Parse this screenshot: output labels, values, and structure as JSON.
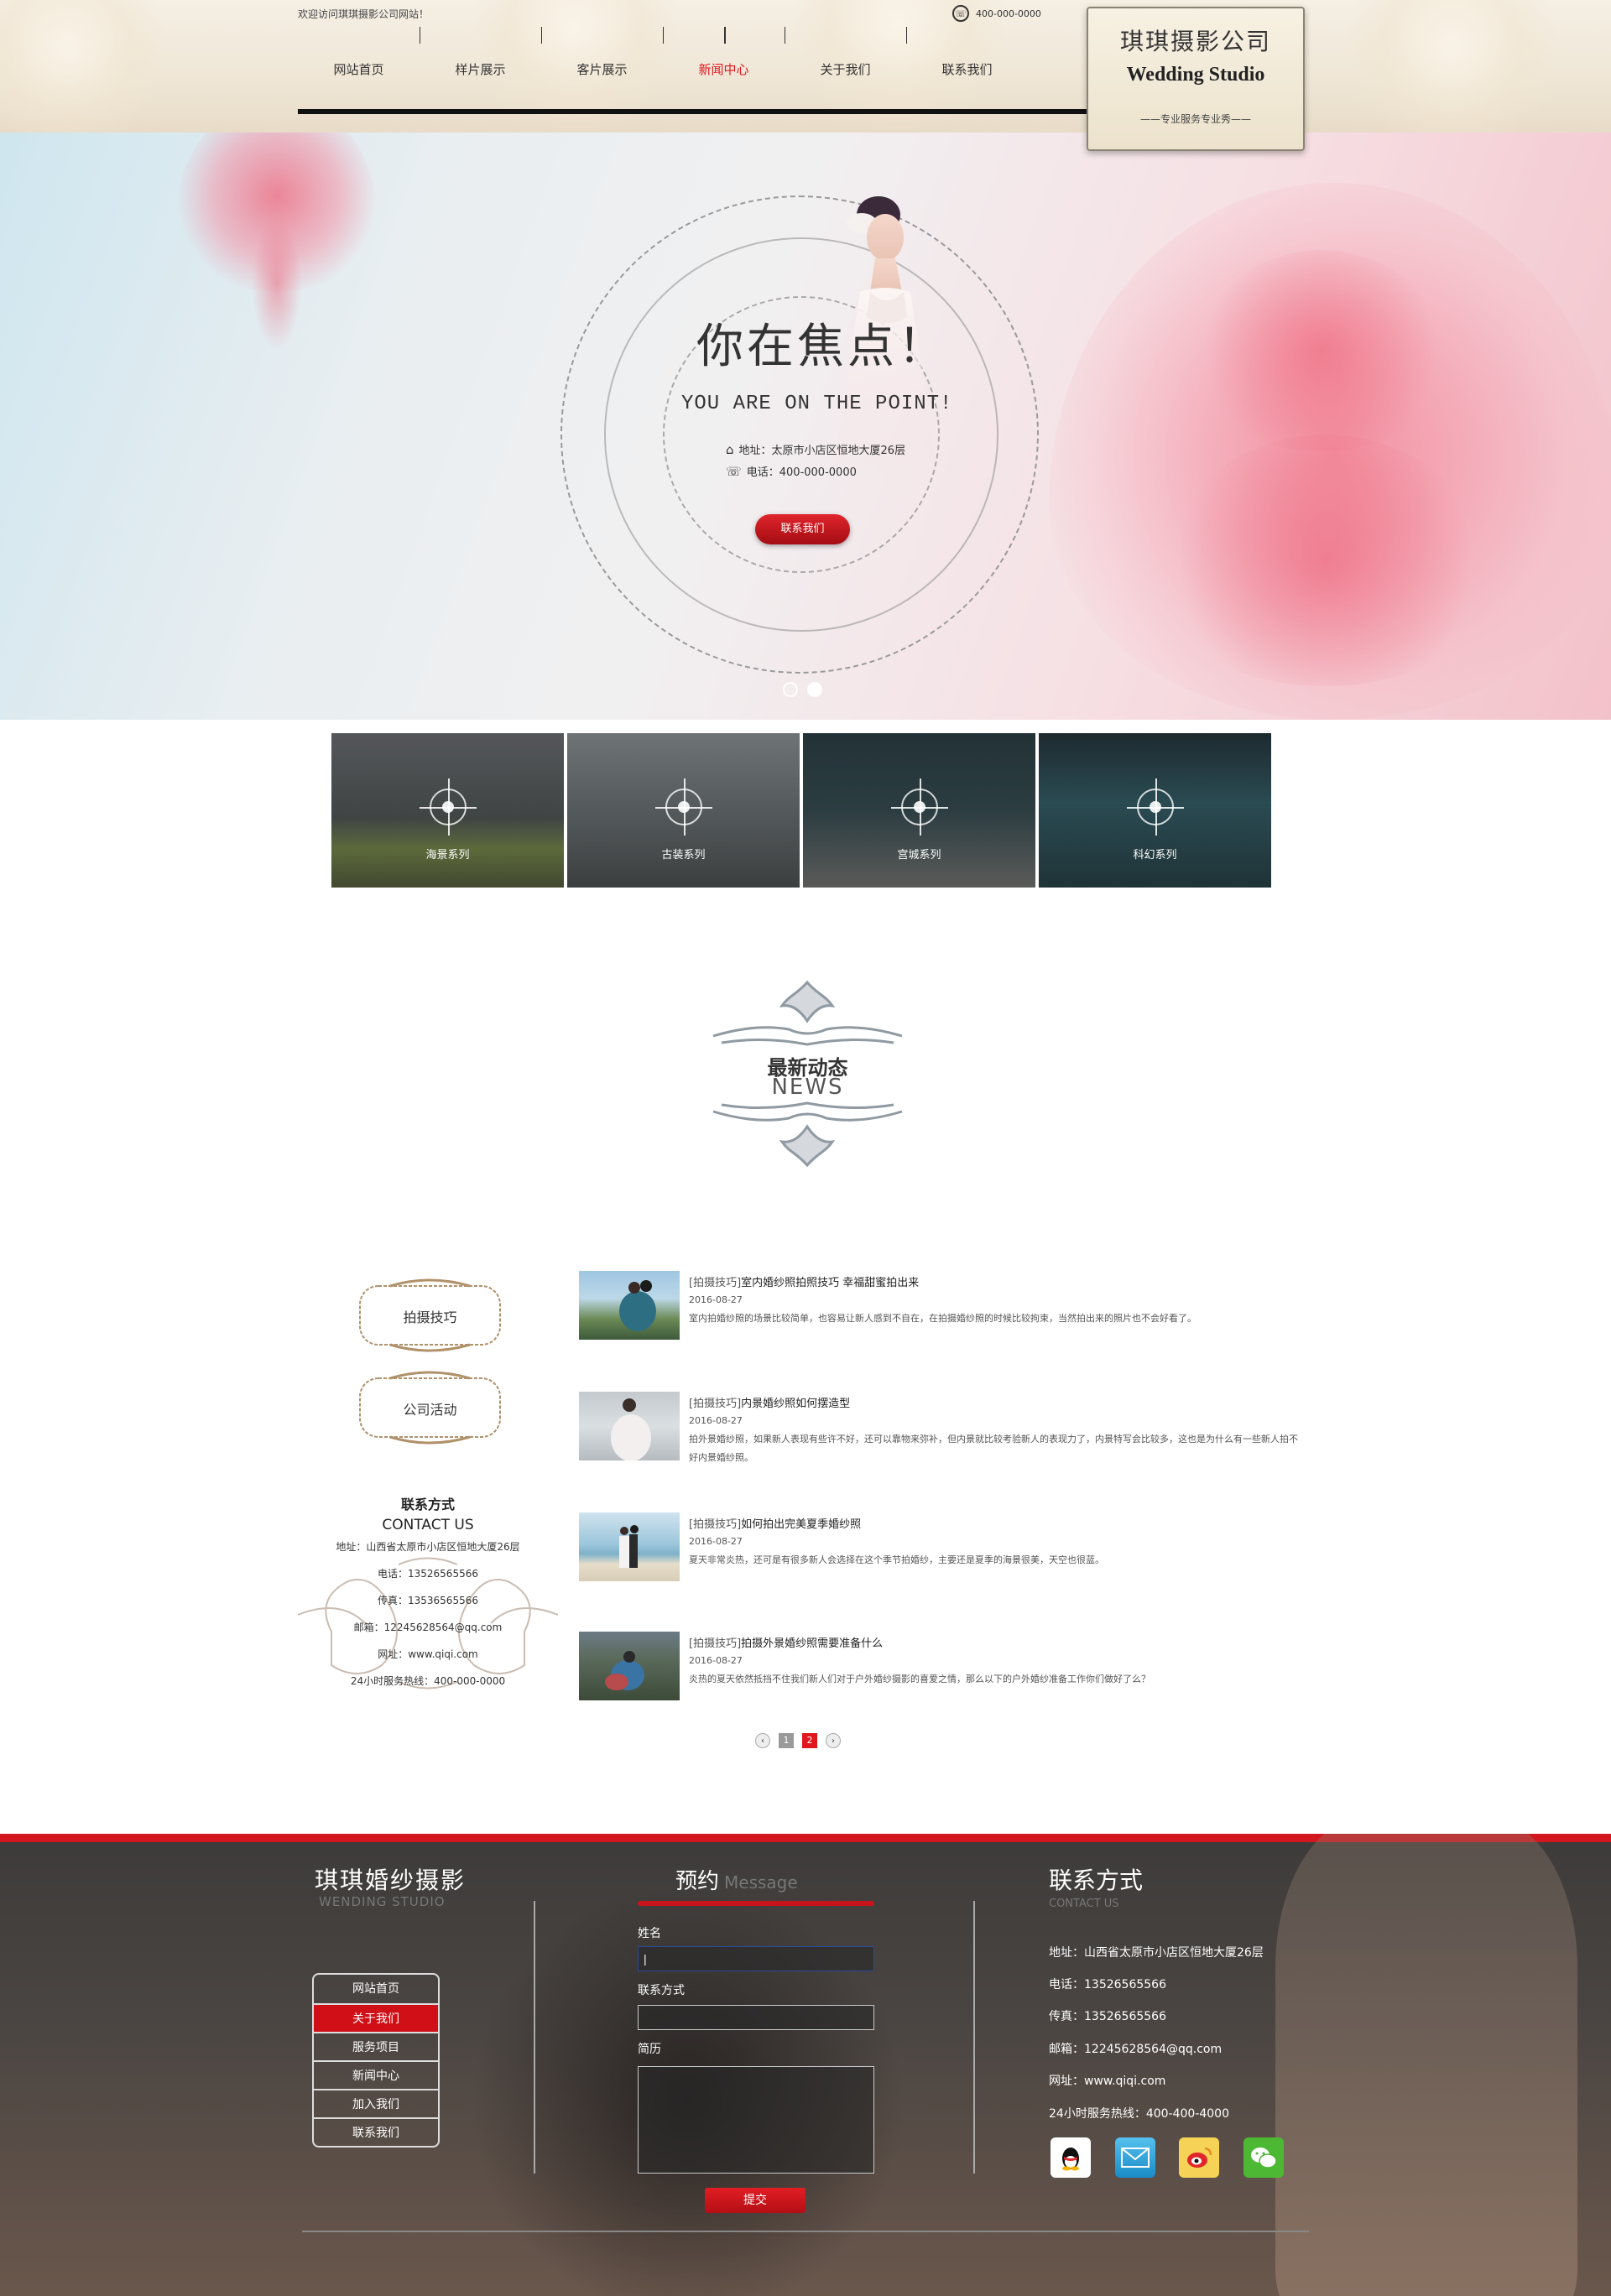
{
  "header": {
    "welcome": "欢迎访问琪琪摄影公司网站！",
    "phone": "400-000-0000",
    "nav": [
      "网站首页",
      "样片展示",
      "客片展示",
      "新闻中心",
      "关于我们",
      "联系我们"
    ],
    "active_nav": "新闻中心",
    "logo_cn": "琪琪摄影公司",
    "logo_en": "Wedding Studio",
    "logo_sub": "——专业服务专业秀——"
  },
  "banner": {
    "title": "你在焦点！",
    "subtitle": "YOU ARE ON THE POINT!",
    "address": "地址：太原市小店区恒地大厦26层",
    "phone": "电话：400-000-0000",
    "button": "联系我们",
    "slides_total": 2,
    "slide_active": 2
  },
  "series": [
    {
      "label": "海景系列"
    },
    {
      "label": "古装系列"
    },
    {
      "label": "宫城系列"
    },
    {
      "label": "科幻系列"
    }
  ],
  "news_heading": {
    "cn": "最新动态",
    "en": "NEWS"
  },
  "categories": [
    "拍摄技巧",
    "公司活动"
  ],
  "contact": {
    "title": "联系方式",
    "title_en": "CONTACT US",
    "address": "地址：山西省太原市小店区恒地大厦26层",
    "phone": "电话：13526565566",
    "fax": "传真：13536565566",
    "email": "邮箱：12245628564@qq.com",
    "web": "网址：www.qiqi.com",
    "hotline": "24小时服务热线：400-000-0000"
  },
  "news": [
    {
      "tag": "[拍摄技巧]",
      "title": "室内婚纱照拍照技巧 幸福甜蜜拍出来",
      "date": "2016-08-27",
      "desc": "室内拍婚纱照的场景比较简单，也容易让新人感到不自在，在拍摄婚纱照的时候比较拘束，当然拍出来的照片也不会好看了。"
    },
    {
      "tag": "[拍摄技巧]",
      "title": "内景婚纱照如何摆造型",
      "date": "2016-08-27",
      "desc": "拍外景婚纱照，如果新人表现有些许不好，还可以靠物来弥补，但内景就比较考验新人的表现力了，内景特写会比较多，这也是为什么有一些新人拍不好内景婚纱照。"
    },
    {
      "tag": "[拍摄技巧]",
      "title": "如何拍出完美夏季婚纱照",
      "date": "2016-08-27",
      "desc": "夏天非常炎热，还可是有很多新人会选择在这个季节拍婚纱，主要还是夏季的海景很美，天空也很蓝。"
    },
    {
      "tag": "[拍摄技巧]",
      "title": "拍摄外景婚纱照需要准备什么",
      "date": "2016-08-27",
      "desc": "炎热的夏天依然抵挡不住我们新人们对于户外婚纱摄影的喜爱之情，那么以下的户外婚纱准备工作你们做好了么？"
    }
  ],
  "pager": {
    "prev": "‹",
    "pages": [
      "1",
      "2"
    ],
    "current": "2",
    "next": "›"
  },
  "footer": {
    "brand": "琪琪婚纱摄影",
    "brand_en": "WENDING STUDIO",
    "menu": [
      "网站首页",
      "关于我们",
      "服务项目",
      "新闻中心",
      "加入我们",
      "联系我们"
    ],
    "menu_active": "关于我们",
    "form_title": "预约",
    "form_title_en": "Message",
    "name_label": "姓名",
    "contact_label": "联系方式",
    "resume_label": "简历",
    "name_value": "|",
    "submit": "提交",
    "contact_title": "联系方式",
    "contact_en": "CONTACT US",
    "address": "地址：山西省太原市小店区恒地大厦26层",
    "phone": "电话：13526565566",
    "fax": "传真：13526565566",
    "email": "邮箱：12245628564@qq.com",
    "web": "网址：www.qiqi.com",
    "hotline": "24小时服务热线：400-400-4000",
    "social": [
      "qq-icon",
      "mail-icon",
      "weibo-icon",
      "wechat-icon"
    ]
  },
  "colors": {
    "accent": "#e1171e",
    "footer_bar": "#d2171e",
    "footer_bg": "#3d3b3a"
  }
}
